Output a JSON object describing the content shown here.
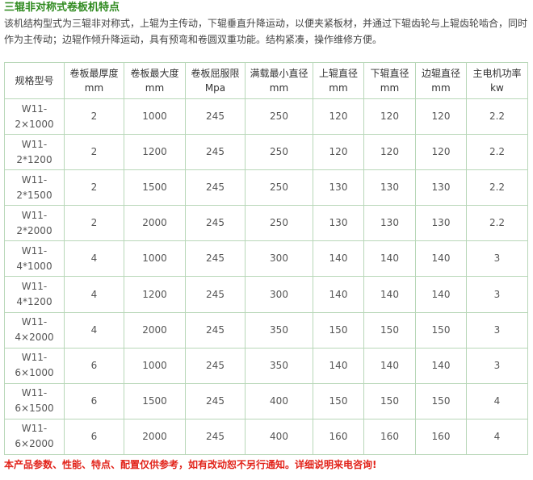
{
  "heading": "三辊非对称式卷板机特点",
  "intro": "该机结构型式为三辊非对称式，上辊为主传动，下辊垂直升降运动，以便夹紧板材，并通过下辊齿轮与上辊齿轮啮合，同时作为主传动；边辊作倾升降运动，具有预弯和卷圆双重功能。结构紧凑，操作维修方便。",
  "table": {
    "headers": [
      {
        "title": "规格型号",
        "unit": ""
      },
      {
        "title": "卷板最厚度",
        "unit": "mm"
      },
      {
        "title": "卷板最大度",
        "unit": "mm"
      },
      {
        "title": "卷板屈服限",
        "unit": "Mpa"
      },
      {
        "title": "满载最小直径",
        "unit": "mm"
      },
      {
        "title": "上辊直径",
        "unit": "mm"
      },
      {
        "title": "下辊直径",
        "unit": "mm"
      },
      {
        "title": "边辊直径",
        "unit": "mm"
      },
      {
        "title": "主电机功率",
        "unit": "kw"
      }
    ],
    "rows": [
      {
        "model_a": "W11-",
        "model_b": "2×1000",
        "cells": [
          "2",
          "1000",
          "245",
          "250",
          "120",
          "120",
          "120",
          "2.2"
        ]
      },
      {
        "model_a": "W11-",
        "model_b": "2*1200",
        "cells": [
          "2",
          "1200",
          "245",
          "250",
          "120",
          "120",
          "120",
          "2.2"
        ]
      },
      {
        "model_a": "W11-",
        "model_b": "2*1500",
        "cells": [
          "2",
          "1500",
          "245",
          "250",
          "130",
          "130",
          "130",
          "2.2"
        ]
      },
      {
        "model_a": "W11-",
        "model_b": "2*2000",
        "cells": [
          "2",
          "2000",
          "245",
          "250",
          "130",
          "130",
          "130",
          "2.2"
        ]
      },
      {
        "model_a": "W11-",
        "model_b": "4*1000",
        "cells": [
          "4",
          "1000",
          "245",
          "300",
          "140",
          "140",
          "140",
          "3"
        ]
      },
      {
        "model_a": "W11-",
        "model_b": "4*1200",
        "cells": [
          "4",
          "1200",
          "245",
          "300",
          "140",
          "140",
          "140",
          "3"
        ]
      },
      {
        "model_a": "W11-",
        "model_b": "4×2000",
        "cells": [
          "4",
          "2000",
          "245",
          "350",
          "150",
          "150",
          "150",
          "3"
        ]
      },
      {
        "model_a": "W11-",
        "model_b": "6×1000",
        "cells": [
          "6",
          "1000",
          "245",
          "350",
          "140",
          "140",
          "140",
          "3"
        ]
      },
      {
        "model_a": "W11-",
        "model_b": "6×1500",
        "cells": [
          "6",
          "1500",
          "245",
          "400",
          "150",
          "150",
          "150",
          "4"
        ]
      },
      {
        "model_a": "W11-",
        "model_b": "6×2000",
        "cells": [
          "6",
          "2000",
          "245",
          "400",
          "160",
          "160",
          "160",
          "4"
        ]
      }
    ]
  },
  "footer": "本产品参数、性能、特点、配置仅供参考，如有改动恕不另行通知。详细说明来电咨询!",
  "colors": {
    "heading": "#2f8a1f",
    "border": "#b8d7b8",
    "footer": "#e2231a"
  }
}
